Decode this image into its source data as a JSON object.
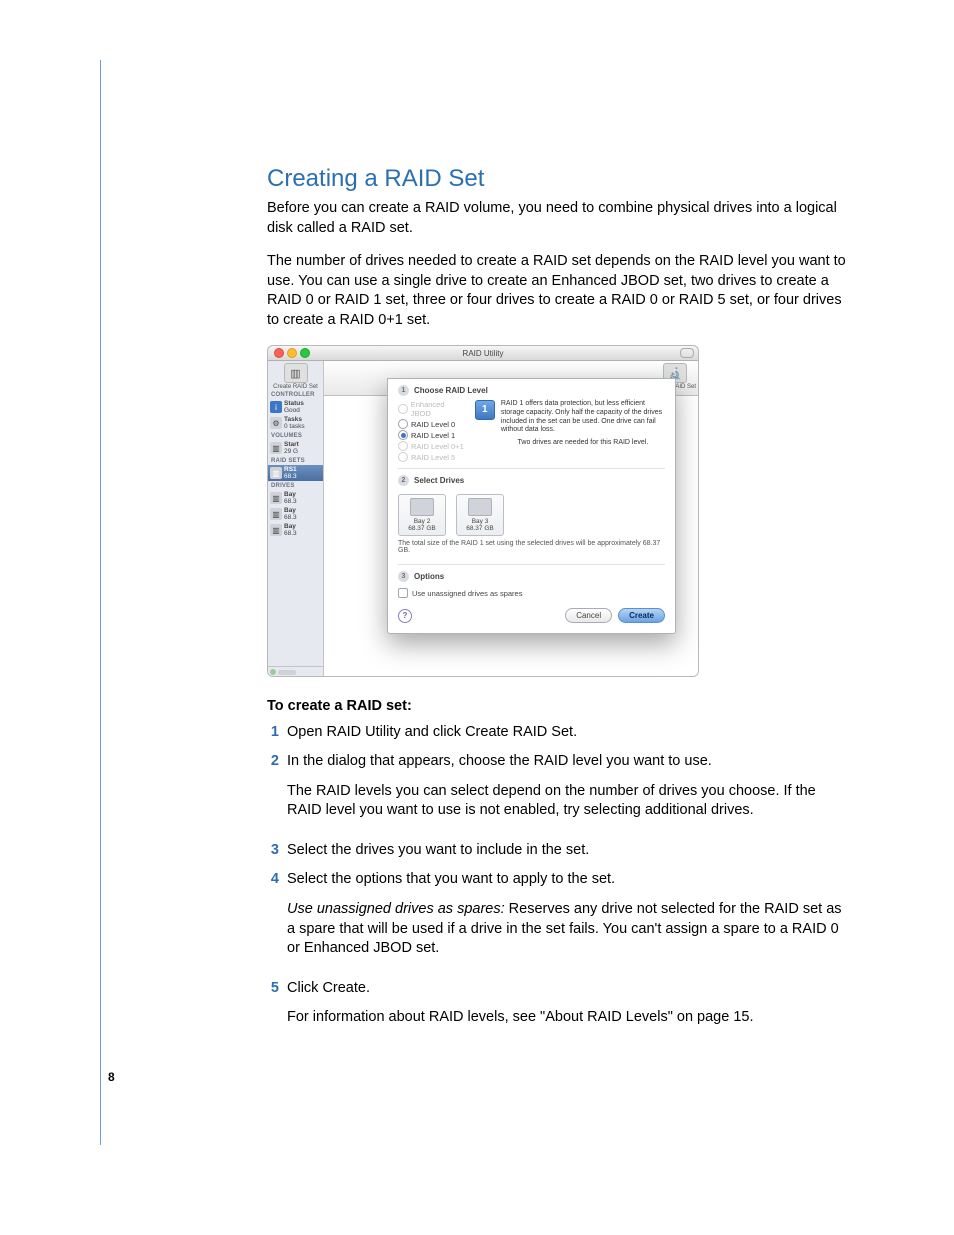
{
  "page": {
    "number": "8"
  },
  "doc": {
    "heading": "Creating a RAID Set",
    "intro1": "Before you can create a RAID volume, you need to combine physical drives into a logical disk called a RAID set.",
    "intro2": "The number of drives needed to create a RAID set depends on the RAID level you want to use. You can use a single drive to create an Enhanced JBOD set, two drives to create a RAID 0 or RAID 1 set, three or four drives to create a RAID 0 or RAID 5 set, or four drives to create a RAID 0+1 set.",
    "steps_heading": "To create a RAID set:",
    "steps": {
      "n1": "1",
      "s1": "Open RAID Utility and click Create RAID Set.",
      "n2": "2",
      "s2": "In the dialog that appears, choose the RAID level you want to use.",
      "s2b": "The RAID levels you can select depend on the number of drives you choose. If the RAID level you want to use is not enabled, try selecting additional drives.",
      "n3": "3",
      "s3": "Select the drives you want to include in the set.",
      "n4": "4",
      "s4": "Select the options that you want to apply to the set.",
      "s4_term": "Use unassigned drives as spares:",
      "s4_def": "  Reserves any drive not selected for the RAID set as a spare that will be used if a drive in the set fails. You can't assign a spare to a RAID 0 or Enhanced JBOD set.",
      "n5": "5",
      "s5": "Click Create.",
      "s5b": "For information about RAID levels, see \"About RAID Levels\" on page 15."
    }
  },
  "shot": {
    "title": "RAID Utility",
    "toolbar": {
      "left": "Create RAID Set",
      "right": "Verify RAID Set"
    },
    "sidebar": {
      "h1": "CONTROLLER",
      "i1a": "Status",
      "i1b": "Good",
      "i2a": "Tasks",
      "i2b": "0 tasks",
      "h2": "VOLUMES",
      "i3a": "Start",
      "i3b": "29 G",
      "h3": "RAID SETS",
      "i4a": "RS1",
      "i4b": "68.3",
      "h4": "DRIVES",
      "i5a": "Bay",
      "i5b": "68.3",
      "i6a": "Bay",
      "i6b": "68.3",
      "i7a": "Bay",
      "i7b": "68.3"
    },
    "dlg": {
      "sec1_num": "1",
      "sec1": "Choose RAID Level",
      "opt_jbod": "Enhanced JBOD",
      "opt_r0": "RAID Level 0",
      "opt_r1": "RAID Level 1",
      "opt_r01": "RAID Level 0+1",
      "opt_r5": "RAID Level 5",
      "badge": "1",
      "info1": "RAID 1 offers data protection, but less efficient storage capacity. Only half the capacity of the drives included in the set can be used. One drive can fail without data loss.",
      "info2": "Two drives are needed for this RAID level.",
      "sec2_num": "2",
      "sec2": "Select Drives",
      "d1_name": "Bay 2",
      "d1_size": "68.37 GB",
      "d2_name": "Bay 3",
      "d2_size": "68.37 GB",
      "size_note": "The total size of the RAID 1 set using the selected drives will be approximately 68.37 GB.",
      "sec3_num": "3",
      "sec3": "Options",
      "spares": "Use unassigned drives as spares",
      "help": "?",
      "cancel": "Cancel",
      "create": "Create"
    }
  }
}
